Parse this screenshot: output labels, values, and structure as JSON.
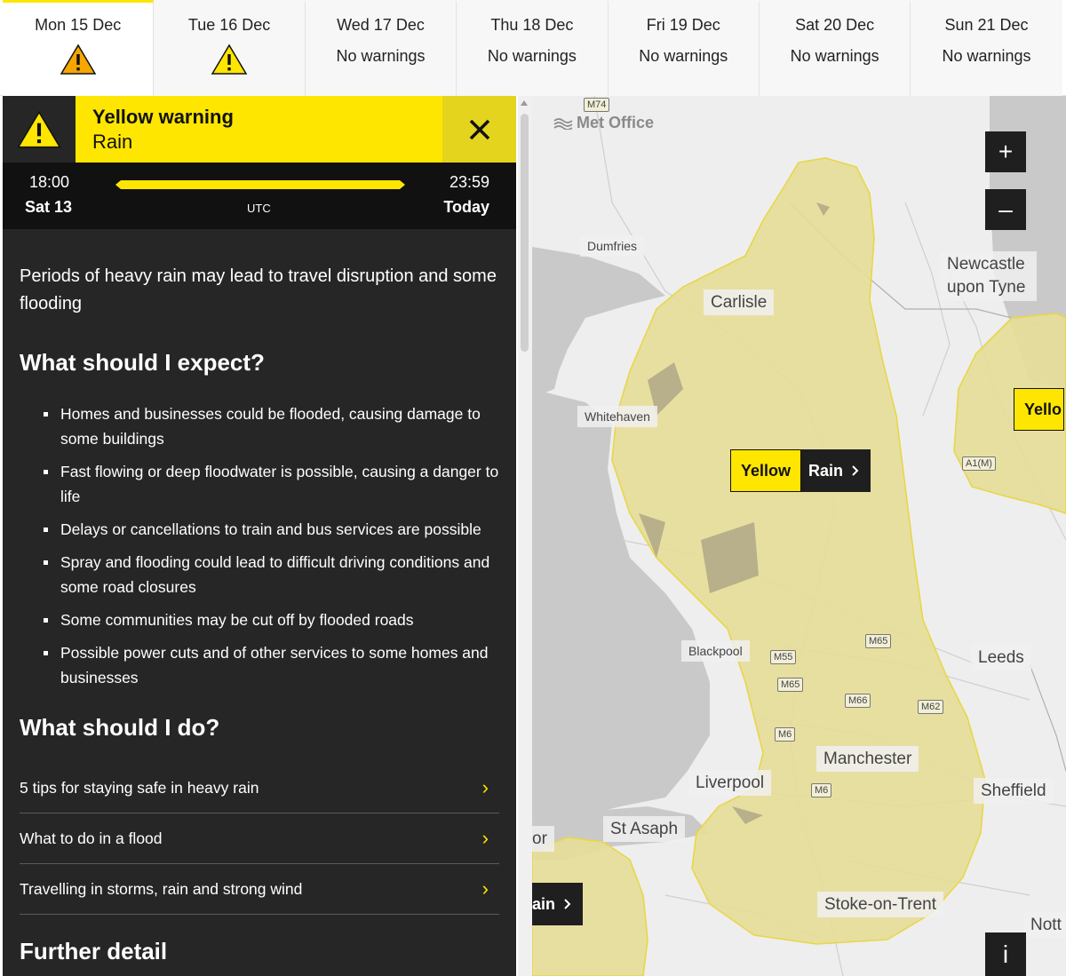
{
  "tabs": [
    {
      "date": "Mon 15 Dec",
      "status": "",
      "icon": "warning-triangle-icon",
      "active": true
    },
    {
      "date": "Tue 16 Dec",
      "status": "",
      "icon": "warning-triangle-icon",
      "active": false
    },
    {
      "date": "Wed 17 Dec",
      "status": "No warnings",
      "icon": "",
      "active": false
    },
    {
      "date": "Thu 18 Dec",
      "status": "No warnings",
      "icon": "",
      "active": false
    },
    {
      "date": "Fri 19 Dec",
      "status": "No warnings",
      "icon": "",
      "active": false
    },
    {
      "date": "Sat 20 Dec",
      "status": "No warnings",
      "icon": "",
      "active": false
    },
    {
      "date": "Sun 21 Dec",
      "status": "No warnings",
      "icon": "",
      "active": false
    }
  ],
  "warning": {
    "title": "Yellow warning",
    "type": "Rain",
    "icon": "warning-triangle-icon",
    "close_icon": "close-icon",
    "start_time": "18:00",
    "start_day": "Sat 13",
    "end_time": "23:59",
    "end_day": "Today",
    "timezone": "UTC",
    "summary": "Periods of heavy rain may lead to travel disruption and some flooding"
  },
  "expect": {
    "heading": "What should I expect?",
    "items": [
      "Homes and businesses could be flooded, causing damage to some buildings",
      "Fast flowing or deep floodwater is possible, causing a danger to life",
      "Delays or cancellations to train and bus services are possible",
      "Spray and flooding could lead to difficult driving conditions and some road closures",
      "Some communities may be cut off by flooded roads",
      "Possible power cuts and of other services to some homes and businesses"
    ]
  },
  "do": {
    "heading": "What should I do?",
    "links": [
      "5 tips for staying safe in heavy rain",
      "What to do in a flood",
      "Travelling in storms, rain and strong wind"
    ]
  },
  "further": {
    "heading": "Further detail"
  },
  "map": {
    "brand": "Met Office",
    "zoom_in": "+",
    "zoom_out": "–",
    "info": "i",
    "places": {
      "dumfries": "Dumfries",
      "carlisle": "Carlisle",
      "newcastle": "Newcastle upon Tyne",
      "whitehaven": "Whitehaven",
      "blackpool": "Blackpool",
      "leeds": "Leeds",
      "manchester": "Manchester",
      "liverpool": "Liverpool",
      "sheffield": "Sheffield",
      "st_asaph": "St Asaph",
      "stoke": "Stoke-on-Trent",
      "nott": "Nott",
      "or": "or"
    },
    "roads": {
      "m74": "M74",
      "a1m": "A1(M)",
      "m65a": "M65",
      "m55": "M55",
      "m65b": "M65",
      "m66": "M66",
      "m62": "M62",
      "m6a": "M6",
      "m6b": "M6"
    },
    "pill_main": {
      "level": "Yellow",
      "type": "Rain"
    },
    "pill_right": {
      "level": "Yello"
    },
    "pill_left": {
      "type": "ain"
    },
    "colors": {
      "sea": "#c9c9c9",
      "land": "#eeeeee",
      "warning_fill": "#e6dd99",
      "warning_stroke": "#e8d64a",
      "yellow": "#ffe600"
    }
  }
}
